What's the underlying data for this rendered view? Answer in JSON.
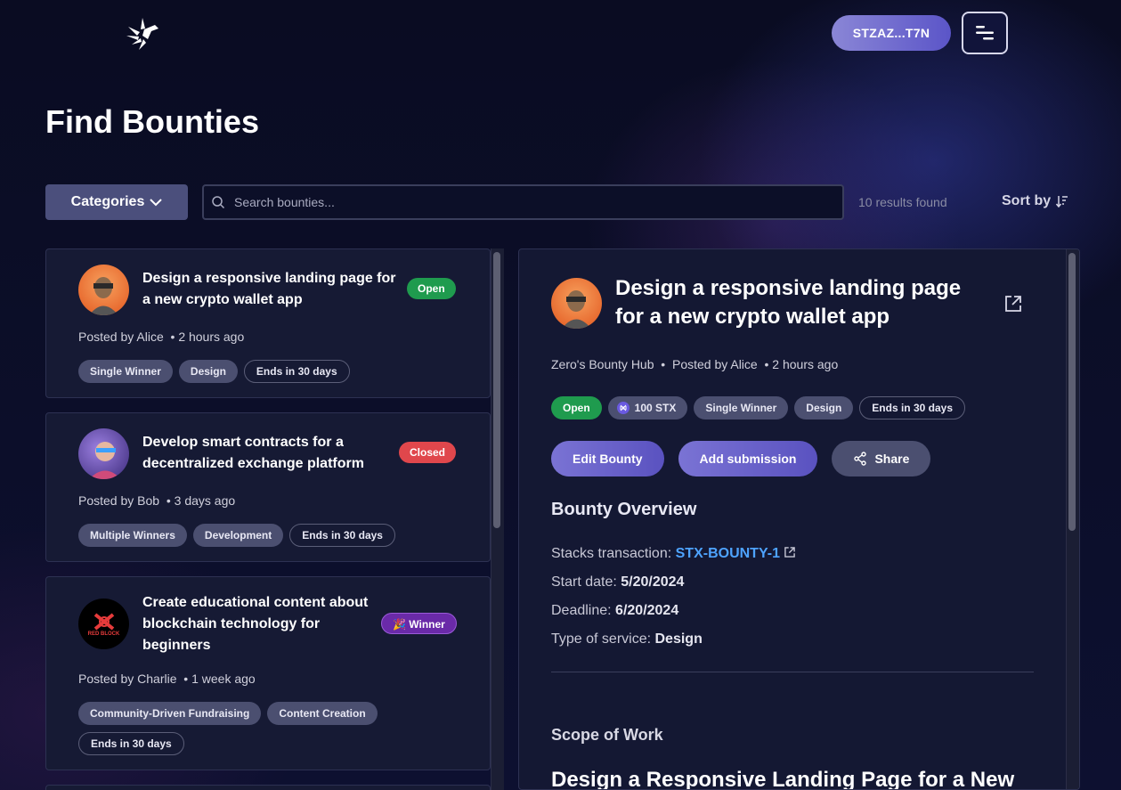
{
  "header": {
    "wallet_label": "STZAZ...T7N"
  },
  "page_title": "Find Bounties",
  "filters": {
    "categories_label": "Categories",
    "search_placeholder": "Search bounties...",
    "results_text": "10 results found",
    "sort_label": "Sort by"
  },
  "bounties": [
    {
      "title_line1": "Design a responsive landing page for",
      "title_line2": "a new crypto wallet app",
      "status": "Open",
      "posted_by": "Posted by Alice",
      "time": "2 hours ago",
      "tags": [
        "Single Winner",
        "Design"
      ],
      "ends": "Ends in 30 days"
    },
    {
      "title_line1": "Develop smart contracts for a",
      "title_line2": "decentralized exchange platform",
      "status": "Closed",
      "posted_by": "Posted by Bob",
      "time": "3 days ago",
      "tags": [
        "Multiple Winners",
        "Development"
      ],
      "ends": "Ends in 30 days"
    },
    {
      "title_line1": "Create educational content about",
      "title_line2": "blockchain technology for",
      "title_line3": "beginners",
      "status": "🎉 Winner",
      "posted_by": "Posted by Charlie",
      "time": "1 week ago",
      "tags": [
        "Community-Driven Fundraising",
        "Content Creation"
      ],
      "ends": "Ends in 30 days",
      "avatar_text": "RED BLOCK"
    }
  ],
  "detail": {
    "title_line1": "Design a responsive landing page",
    "title_line2": "for a new crypto wallet app",
    "hub": "Zero's Bounty Hub",
    "posted_by": "Posted by Alice",
    "time": "2 hours ago",
    "status": "Open",
    "reward": "100 STX",
    "tags": [
      "Single Winner",
      "Design"
    ],
    "ends": "Ends in 30 days",
    "edit_label": "Edit Bounty",
    "submit_label": "Add submission",
    "share_label": "Share",
    "overview_heading": "Bounty Overview",
    "tx_label": "Stacks transaction: ",
    "tx_value": "STX-BOUNTY-1",
    "start_label": "Start date: ",
    "start_value": "5/20/2024",
    "deadline_label": "Deadline: ",
    "deadline_value": "6/20/2024",
    "service_label": "Type of service: ",
    "service_value": "Design",
    "scope_heading": "Scope of Work",
    "scope_title": "Design a Responsive Landing Page for a New"
  },
  "colors": {
    "open": "#1f9b4e",
    "closed": "#e0474c",
    "winner": "#6a2aa8",
    "link": "#4ea3ff",
    "accent": "#6a63cc"
  },
  "icons": [
    "logo-bird-icon",
    "menu-icon",
    "chevron-down-icon",
    "search-icon",
    "sort-icon",
    "external-link-icon",
    "stx-token-icon",
    "share-icon"
  ]
}
